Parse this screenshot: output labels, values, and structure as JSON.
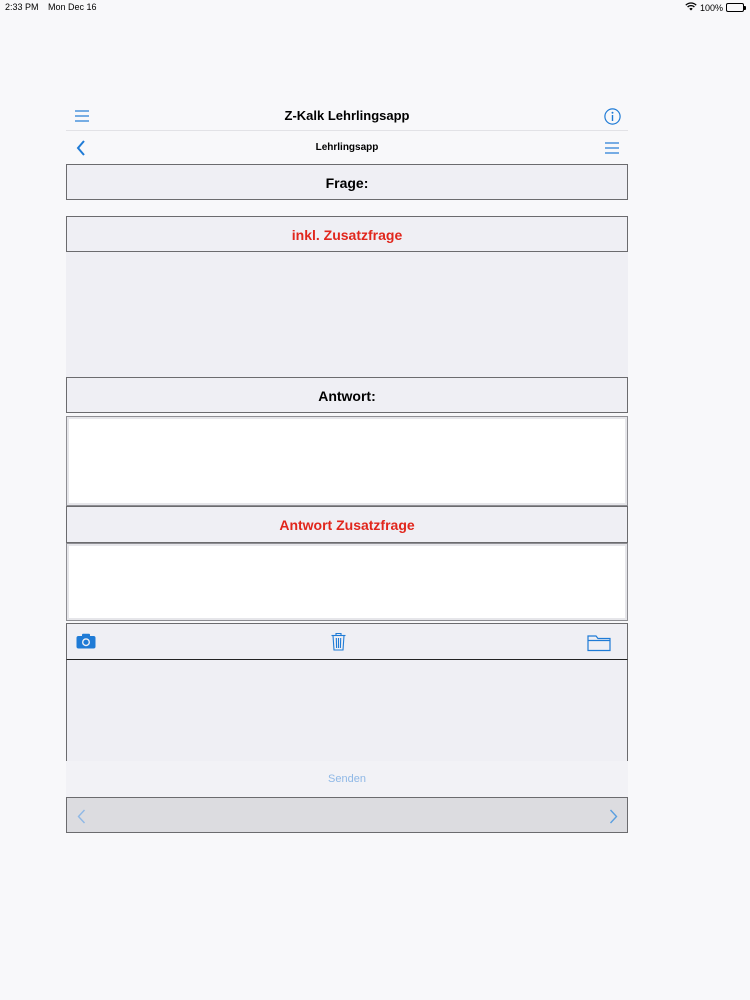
{
  "status_bar": {
    "time": "2:33 PM",
    "date": "Mon Dec 16",
    "battery": "100%"
  },
  "header": {
    "title": "Z-Kalk Lehrlingsapp"
  },
  "subheader": {
    "title": "Lehrlingsapp"
  },
  "question": {
    "label": "Frage:",
    "extra_label": "inkl. Zusatzfrage"
  },
  "answer": {
    "label": "Antwort:",
    "extra_label": "Antwort Zusatzfrage",
    "value": "",
    "extra_value": ""
  },
  "toolbar": {
    "camera": "camera-icon",
    "trash": "trash-icon",
    "folder": "folder-icon"
  },
  "send": {
    "label": "Senden"
  },
  "colors": {
    "accent": "#1f7bd6",
    "red": "#e1261c",
    "disabled": "#8fb8e6"
  }
}
